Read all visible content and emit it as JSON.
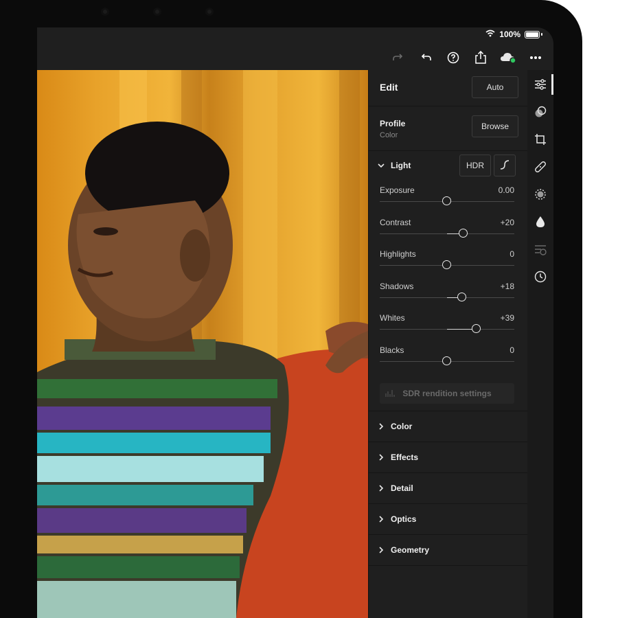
{
  "status": {
    "battery": "100%"
  },
  "toolbar": {
    "icons": [
      "redo-icon",
      "undo-icon",
      "help-icon",
      "share-icon",
      "cloud-sync-icon",
      "more-icon"
    ]
  },
  "panel": {
    "title": "Edit",
    "auto_label": "Auto",
    "profile": {
      "title": "Profile",
      "subtitle": "Color",
      "browse_label": "Browse"
    },
    "light": {
      "title": "Light",
      "hdr_label": "HDR",
      "sliders": [
        {
          "label": "Exposure",
          "value": "0.00",
          "position": 0.5
        },
        {
          "label": "Contrast",
          "value": "+20",
          "position": 0.62
        },
        {
          "label": "Highlights",
          "value": "0",
          "position": 0.5
        },
        {
          "label": "Shadows",
          "value": "+18",
          "position": 0.61
        },
        {
          "label": "Whites",
          "value": "+39",
          "position": 0.72
        },
        {
          "label": "Blacks",
          "value": "0",
          "position": 0.5
        }
      ],
      "sdr_label": "SDR rendition settings"
    },
    "sections": [
      {
        "label": "Color"
      },
      {
        "label": "Effects"
      },
      {
        "label": "Detail"
      },
      {
        "label": "Optics"
      },
      {
        "label": "Geometry"
      }
    ]
  },
  "rail": {
    "icons": [
      "edit-sliders-icon",
      "presets-icon",
      "crop-icon",
      "healing-icon",
      "masking-icon",
      "drop-icon",
      "versions-icon",
      "history-icon"
    ],
    "active_index": 0
  }
}
